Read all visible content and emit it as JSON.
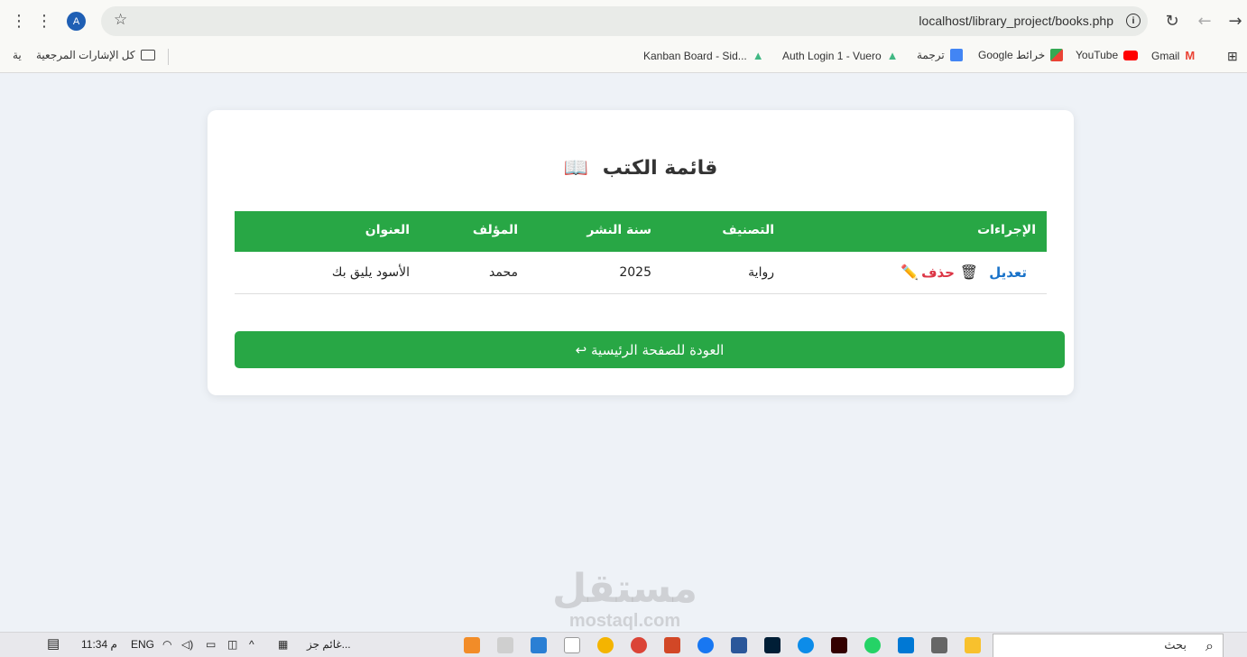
{
  "browser": {
    "url": "localhost/library_project/books.php",
    "avatar_letter": "A",
    "bookmarks": [
      {
        "label": "ية"
      },
      {
        "label": "كل الإشارات المرجعية"
      },
      {
        "label": "Kanban Board - Sid..."
      },
      {
        "label": "Auth Login 1 - Vuero"
      },
      {
        "label": "ترجمة"
      },
      {
        "label": "Google خرائط"
      },
      {
        "label": "YouTube"
      },
      {
        "label": "Gmail"
      }
    ]
  },
  "page": {
    "title": "قائمة الكتب",
    "title_icon": "📖",
    "table": {
      "headers": {
        "actions": "الإجراءات",
        "category": "التصنيف",
        "year": "سنة النشر",
        "author": "المؤلف",
        "title": "العنوان"
      },
      "rows": [
        {
          "title": "الأسود يليق بك",
          "author": "محمد",
          "year": "2025",
          "category": "رواية",
          "edit_label": "تعديل",
          "delete_label": "حذف"
        }
      ]
    },
    "back_button": "العودة للصفحة الرئيسية ↩"
  },
  "watermark": {
    "arabic": "مستقل",
    "latin": "mostaql.com"
  },
  "taskbar": {
    "time": "11:34 م",
    "language": "ENG",
    "weather": "غائم جز...",
    "search_placeholder": "بحث"
  },
  "colors": {
    "accent_green": "#28a745",
    "link_blue": "#1a73c9",
    "delete_red": "#dc3545"
  }
}
